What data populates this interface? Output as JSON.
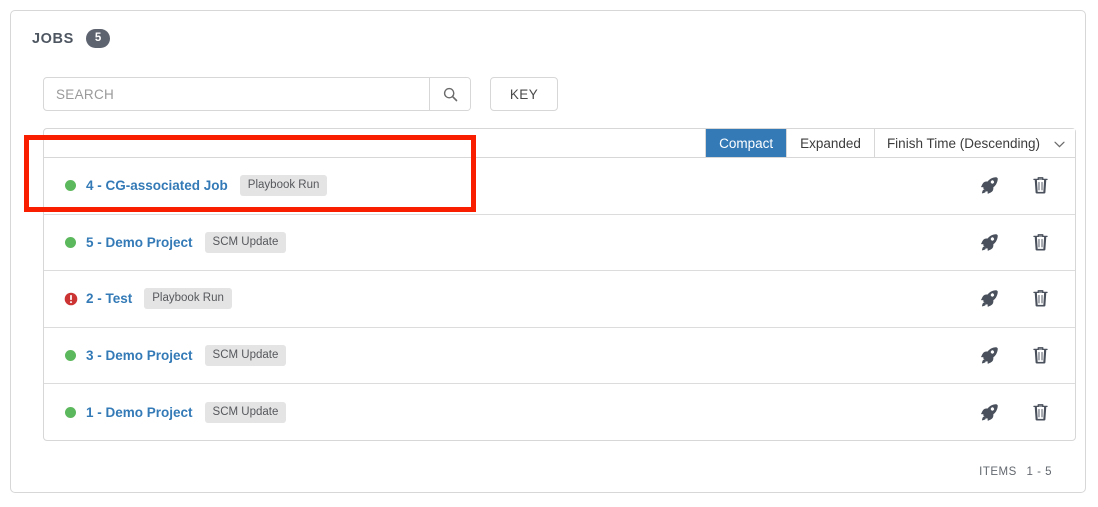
{
  "panel": {
    "title": "JOBS",
    "count": "5"
  },
  "search": {
    "placeholder": "SEARCH",
    "value": "",
    "icon": "search-icon",
    "key_button_label": "KEY"
  },
  "list_toolbar": {
    "compact_label": "Compact",
    "expanded_label": "Expanded",
    "active_view": "Compact",
    "sort_value": "Finish Time (Descending)",
    "sort_caret": "⌄"
  },
  "jobs": [
    {
      "status": "success",
      "status_icon": "green-circle-icon",
      "title": "4 - CG-associated Job",
      "type": "Playbook Run",
      "relaunch_icon": "rocket-icon",
      "delete_icon": "trash-icon",
      "highlighted": true
    },
    {
      "status": "success",
      "status_icon": "green-circle-icon",
      "title": "5 - Demo Project",
      "type": "SCM Update",
      "relaunch_icon": "rocket-icon",
      "delete_icon": "trash-icon",
      "highlighted": false
    },
    {
      "status": "failed",
      "status_icon": "red-exclamation-circle-icon",
      "title": "2 - Test",
      "type": "Playbook Run",
      "relaunch_icon": "rocket-icon",
      "delete_icon": "trash-icon",
      "highlighted": false
    },
    {
      "status": "success",
      "status_icon": "green-circle-icon",
      "title": "3 - Demo Project",
      "type": "SCM Update",
      "relaunch_icon": "rocket-icon",
      "delete_icon": "trash-icon",
      "highlighted": false
    },
    {
      "status": "success",
      "status_icon": "green-circle-icon",
      "title": "1 - Demo Project",
      "type": "SCM Update",
      "relaunch_icon": "rocket-icon",
      "delete_icon": "trash-icon",
      "highlighted": false
    }
  ],
  "footer": {
    "items_label": "ITEMS",
    "items_range": "1 - 5"
  },
  "colors": {
    "accent_blue": "#337ab7",
    "status_success": "#5cb85c",
    "status_failed": "#cc3333",
    "badge_gray": "#5d636f",
    "highlight_red": "#fa1e00",
    "border_gray": "#d7d7d7"
  }
}
